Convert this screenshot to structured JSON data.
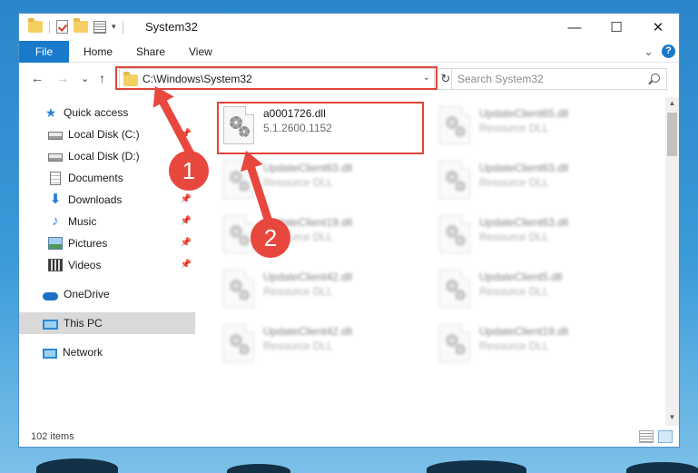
{
  "window": {
    "title": "System32",
    "controls": {
      "minimize": "—",
      "maximize": "☐",
      "close": "✕"
    }
  },
  "ribbon": {
    "tabs": [
      "File",
      "Home",
      "Share",
      "View"
    ],
    "expand_glyph": "⌄",
    "help_glyph": "?"
  },
  "nav": {
    "back": "←",
    "forward": "→",
    "recent": "⌄",
    "up": "↑",
    "address": "C:\\Windows\\System32",
    "address_dd": "⌄",
    "refresh": "↻",
    "search_placeholder": "Search System32"
  },
  "sidebar": {
    "items": [
      {
        "label": "Quick access",
        "icon": "star-icon",
        "pinned": false
      },
      {
        "label": "Local Disk (C:)",
        "icon": "disk-icon",
        "pinned": true
      },
      {
        "label": "Local Disk (D:)",
        "icon": "disk-icon",
        "pinned": false
      },
      {
        "label": "Documents",
        "icon": "document-icon",
        "pinned": true
      },
      {
        "label": "Downloads",
        "icon": "download-icon",
        "pinned": true
      },
      {
        "label": "Music",
        "icon": "music-icon",
        "pinned": true
      },
      {
        "label": "Pictures",
        "icon": "pictures-icon",
        "pinned": true
      },
      {
        "label": "Videos",
        "icon": "video-icon",
        "pinned": true
      },
      {
        "label": "OneDrive",
        "icon": "cloud-icon",
        "pinned": false
      },
      {
        "label": "This PC",
        "icon": "computer-icon",
        "pinned": false,
        "selected": true
      },
      {
        "label": "Network",
        "icon": "network-icon",
        "pinned": false
      }
    ],
    "pin_glyph": "📌"
  },
  "files": [
    {
      "name": "a0001726.dll",
      "sub": "5.1.2600.1152",
      "highlighted": true
    },
    {
      "name": "UpdateClient65.dll",
      "sub": "Resource DLL"
    },
    {
      "name": "UpdateClient63.dll",
      "sub": "Resource DLL"
    },
    {
      "name": "UpdateClient63.dll",
      "sub": "Resource DLL"
    },
    {
      "name": "UpdateClient19.dll",
      "sub": "Resource DLL"
    },
    {
      "name": "UpdateClient63.dll",
      "sub": "Resource DLL"
    },
    {
      "name": "UpdateClient42.dll",
      "sub": "Resource DLL"
    },
    {
      "name": "UpdateClient5.dll",
      "sub": "Resource DLL"
    },
    {
      "name": "UpdateClient42.dll",
      "sub": "Resource DLL"
    },
    {
      "name": "UpdateClient19.dll",
      "sub": "Resource DLL"
    }
  ],
  "status": {
    "items_count": "102 items"
  },
  "annotations": {
    "step1": "1",
    "step2": "2"
  },
  "colors": {
    "accent": "#1979ca",
    "callout": "#e8473e",
    "selection": "#d9d9d9"
  }
}
